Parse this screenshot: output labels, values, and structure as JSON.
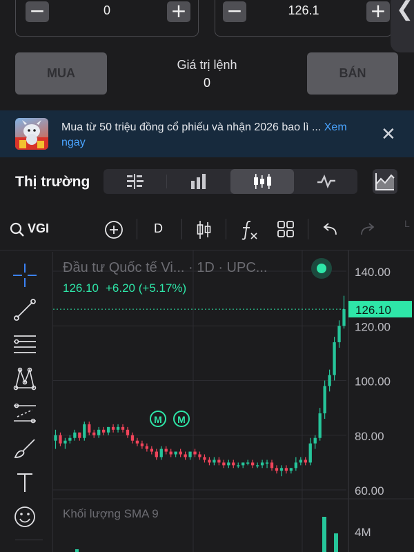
{
  "order": {
    "quantity": "0",
    "price": "126.1",
    "minus": "−",
    "plus": "+",
    "collapse": "❮",
    "buy_label": "MUA",
    "sell_label": "BÁN",
    "order_value_label": "Giá trị lệnh",
    "order_value": "0"
  },
  "banner": {
    "text": "Mua từ 50 triệu đồng cổ phiếu và nhận 2026 bao lì ... ",
    "link_part1": "Xem",
    "link_part2": "ngay",
    "close": "✕"
  },
  "market": {
    "title": "Thị trường",
    "tabs": [
      "order-book-icon",
      "bar-chart-icon",
      "candlestick-icon",
      "line-chart-icon"
    ],
    "active_tab": 2
  },
  "toolbar": {
    "symbol": "VGI",
    "interval": "D",
    "redo_label": "L"
  },
  "chart": {
    "title": "Đầu tư Quốc tế Vi... · 1D · UPC...",
    "price": "126.10",
    "change": "+6.20 (+5.17%)",
    "last_price_tag": "126.10",
    "up_color": "#26c59a",
    "down_color": "#f0445a",
    "accent": "#2ee6a8",
    "marker": "M",
    "volume_label": "Khối lượng SMA 9",
    "volume_tick": "4M"
  },
  "chart_data": {
    "type": "candlestick",
    "y_ticks": [
      "140.00",
      "120.00",
      "100.00",
      "80.00",
      "60.00"
    ],
    "ylim": [
      60,
      140
    ],
    "last_price": 126.1,
    "candles": [
      [
        78,
        82,
        75,
        80
      ],
      [
        80,
        81,
        76,
        77
      ],
      [
        77,
        79,
        75,
        78
      ],
      [
        78,
        80,
        77,
        79
      ],
      [
        79,
        82,
        78,
        81
      ],
      [
        81,
        81,
        78,
        79
      ],
      [
        79,
        85,
        78,
        84
      ],
      [
        84,
        85,
        80,
        81
      ],
      [
        81,
        82,
        79,
        80
      ],
      [
        80,
        83,
        79,
        82
      ],
      [
        82,
        83,
        80,
        81
      ],
      [
        81,
        83,
        80,
        83
      ],
      [
        83,
        84,
        81,
        82
      ],
      [
        82,
        84,
        81,
        83
      ],
      [
        83,
        84,
        81,
        82
      ],
      [
        82,
        83,
        79,
        80
      ],
      [
        80,
        81,
        77,
        78
      ],
      [
        78,
        79,
        76,
        77
      ],
      [
        77,
        78,
        75,
        76
      ],
      [
        76,
        77,
        74,
        75
      ],
      [
        75,
        76,
        73,
        74
      ],
      [
        74,
        75,
        71,
        72
      ],
      [
        72,
        76,
        71,
        75
      ],
      [
        75,
        76,
        73,
        74
      ],
      [
        74,
        75,
        72,
        73
      ],
      [
        73,
        74,
        72,
        74
      ],
      [
        74,
        75,
        72,
        73
      ],
      [
        73,
        74,
        71,
        72
      ],
      [
        72,
        74,
        71,
        74
      ],
      [
        74,
        75,
        72,
        73
      ],
      [
        73,
        74,
        71,
        72
      ],
      [
        72,
        73,
        70,
        71
      ],
      [
        71,
        72,
        69,
        70
      ],
      [
        70,
        72,
        69,
        71
      ],
      [
        71,
        72,
        69,
        70
      ],
      [
        70,
        71,
        68,
        69
      ],
      [
        69,
        71,
        68,
        70
      ],
      [
        70,
        71,
        68,
        69
      ],
      [
        69,
        70,
        68,
        69
      ],
      [
        69,
        70,
        68,
        70
      ],
      [
        70,
        71,
        69,
        70
      ],
      [
        70,
        71,
        68,
        69
      ],
      [
        69,
        70,
        68,
        69
      ],
      [
        69,
        71,
        68,
        70
      ],
      [
        70,
        71,
        68,
        70
      ],
      [
        70,
        71,
        67,
        68
      ],
      [
        68,
        69,
        66,
        67
      ],
      [
        67,
        69,
        65,
        68
      ],
      [
        68,
        69,
        66,
        67
      ],
      [
        67,
        68,
        66,
        68
      ],
      [
        68,
        72,
        67,
        70
      ],
      [
        70,
        72,
        69,
        71
      ],
      [
        71,
        72,
        69,
        70
      ],
      [
        70,
        79,
        69,
        77
      ],
      [
        77,
        80,
        75,
        79
      ],
      [
        79,
        90,
        78,
        88
      ],
      [
        88,
        100,
        86,
        98
      ],
      [
        98,
        104,
        96,
        102
      ],
      [
        102,
        116,
        100,
        114
      ],
      [
        114,
        122,
        112,
        120
      ],
      [
        120,
        131,
        119,
        126.1
      ]
    ],
    "markers": [
      "M",
      "M"
    ],
    "volume": {
      "label": "Khối lượng SMA 9",
      "tick": "4M"
    }
  }
}
